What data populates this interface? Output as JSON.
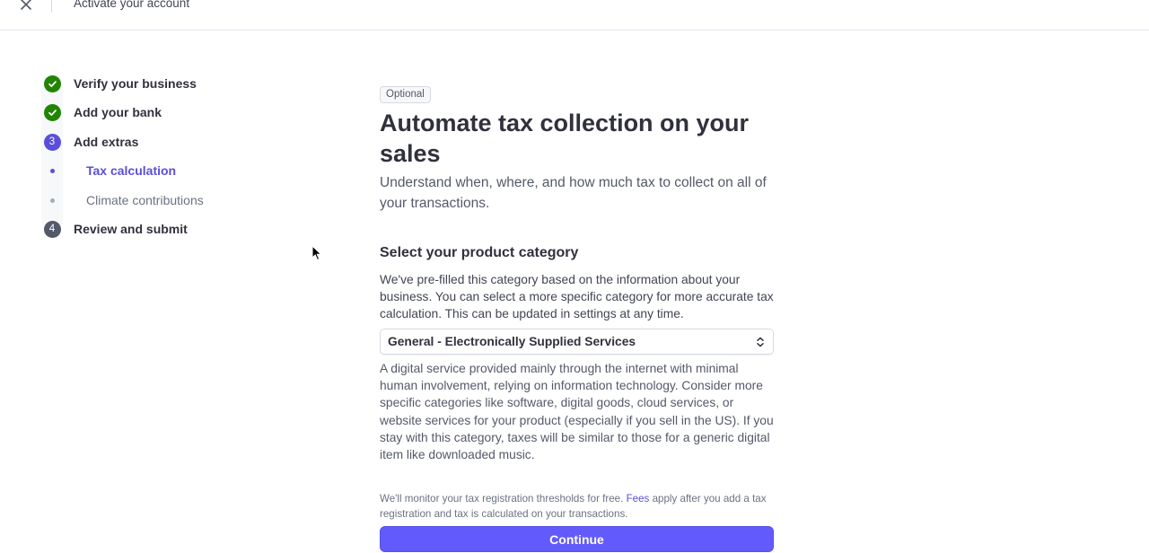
{
  "topbar": {
    "title": "Activate your account",
    "close_icon": "close-icon"
  },
  "stepper": {
    "steps": [
      {
        "label": "Verify your business",
        "state": "completed"
      },
      {
        "label": "Add your bank",
        "state": "completed"
      },
      {
        "label": "Add extras",
        "state": "active",
        "number": "3",
        "substeps": [
          {
            "label": "Tax calculation",
            "state": "active"
          },
          {
            "label": "Climate contributions",
            "state": "pending"
          }
        ]
      },
      {
        "label": "Review and submit",
        "state": "pending",
        "number": "4"
      }
    ]
  },
  "main": {
    "badge": "Optional",
    "title": "Automate tax collection on your sales",
    "subtitle": "Understand when, where, and how much tax to collect on all of your transactions.",
    "section_title": "Select your product category",
    "description": "We've pre-filled this category based on the information about your business. You can select a more specific category for more accurate tax calculation. This can be updated in settings at any time.",
    "category_select": {
      "value": "General - Electronically Supplied Services"
    },
    "category_description": "A digital service provided mainly through the internet with minimal human involvement, relying on information technology. Consider more specific categories like software, digital goods, cloud services, or website services for your product (especially if you sell in the US). If you stay with this category, taxes will be similar to those for a generic digital item like downloaded music.",
    "fine_print": {
      "before": "We'll monitor your tax registration thresholds for free. ",
      "link": "Fees",
      "after": " apply after you add a tax registration and tax is calculated on your transactions."
    },
    "continue_label": "Continue"
  },
  "colors": {
    "accent": "#625afa",
    "success": "#228403",
    "text_primary": "#30313d"
  }
}
